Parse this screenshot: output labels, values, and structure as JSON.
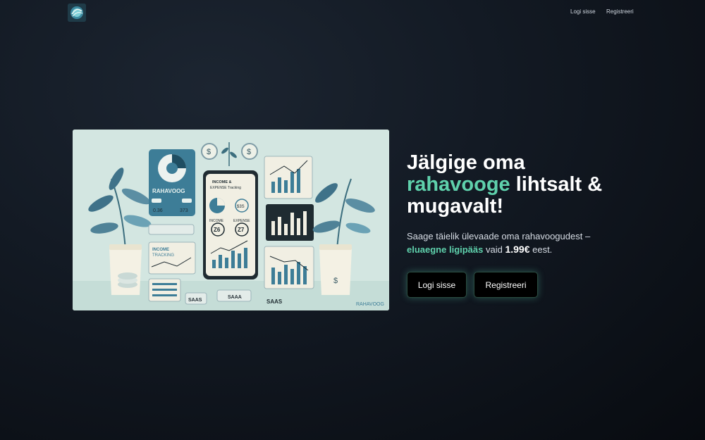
{
  "nav": {
    "login_label": "Logi sisse",
    "register_label": "Registreeri"
  },
  "hero": {
    "headline_line1": "Jälgige oma",
    "headline_accent": "rahavooge",
    "headline_rest": " lihtsalt &",
    "headline_line3": "mugavalt!",
    "sub_part1": "Saage täielik ülevaade oma rahavoogudest –",
    "sub_accent": "eluaegne ligipääs",
    "sub_part2": " vaid ",
    "sub_price": "1.99€",
    "sub_part3": " eest.",
    "login_button": "Logi sisse",
    "register_button": "Registreeri"
  },
  "illustration": {
    "brand": "RAHAVOOG",
    "card_title": "RAHAVOOG",
    "card_values": [
      "0.36",
      "373"
    ],
    "phone_title": "INCOME & EXPENSE Tracking",
    "phone_income": "INCOME",
    "phone_expense": "EXPENSE",
    "phone_income_val": "Z6",
    "phone_expense_val": "Z7",
    "phone_badge": "$3S",
    "side_card": "INCOME TRACKING",
    "saas1": "SAAS",
    "saas2": "SAAA",
    "saas3": "SAAS",
    "watermark": "RAHAVOOG",
    "dollar_signs": "$"
  },
  "colors": {
    "accent": "#5fd1ac",
    "background": "#0f141b",
    "button_bg": "#000000"
  }
}
